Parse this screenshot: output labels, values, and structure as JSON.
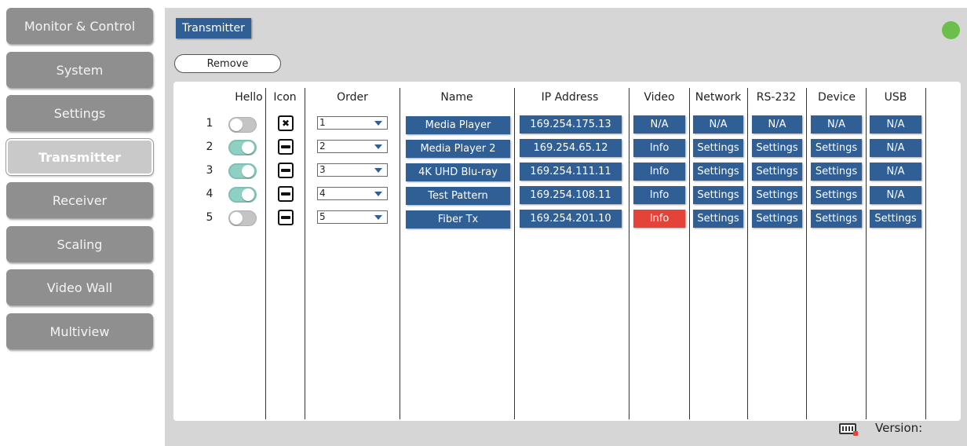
{
  "sidebar": {
    "items": [
      {
        "label": "Monitor & Control"
      },
      {
        "label": "System"
      },
      {
        "label": "Settings"
      },
      {
        "label": "Transmitter",
        "active": true
      },
      {
        "label": "Receiver"
      },
      {
        "label": "Scaling"
      },
      {
        "label": "Video Wall"
      },
      {
        "label": "Multiview"
      }
    ]
  },
  "page": {
    "title": "Transmitter",
    "status_color": "#6cbf4c",
    "remove_label": "Remove"
  },
  "table": {
    "headers": {
      "hello": "Hello",
      "icon": "Icon",
      "order": "Order",
      "name": "Name",
      "ip": "IP Address",
      "video": "Video",
      "network": "Network",
      "rs232": "RS-232",
      "device": "Device",
      "usb": "USB"
    },
    "rows": [
      {
        "num": "1",
        "hello_on": false,
        "icon": "disconnected-icon",
        "order": "1",
        "name": "Media Player",
        "ip": "169.254.175.13",
        "video": "N/A",
        "network": "N/A",
        "rs232": "N/A",
        "device": "N/A",
        "usb": "N/A"
      },
      {
        "num": "2",
        "hello_on": true,
        "icon": "device-icon",
        "order": "2",
        "name": "Media Player 2",
        "ip": "169.254.65.12",
        "video": "Info",
        "network": "Settings",
        "rs232": "Settings",
        "device": "Settings",
        "usb": "N/A"
      },
      {
        "num": "3",
        "hello_on": true,
        "icon": "device-icon",
        "order": "3",
        "name": "4K UHD Blu-ray",
        "ip": "169.254.111.11",
        "video": "Info",
        "network": "Settings",
        "rs232": "Settings",
        "device": "Settings",
        "usb": "N/A"
      },
      {
        "num": "4",
        "hello_on": true,
        "icon": "device-icon",
        "order": "4",
        "name": "Test Pattern",
        "ip": "169.254.108.11",
        "video": "Info",
        "network": "Settings",
        "rs232": "Settings",
        "device": "Settings",
        "usb": "N/A"
      },
      {
        "num": "5",
        "hello_on": false,
        "icon": "device-icon",
        "order": "5",
        "name": "Fiber Tx",
        "ip": "169.254.201.10",
        "video": "Info",
        "video_alert": true,
        "network": "Settings",
        "rs232": "Settings",
        "device": "Settings",
        "usb": "Settings"
      }
    ]
  },
  "footer": {
    "keyboard_icon": "keyboard-icon",
    "version_label": "Version:"
  },
  "colors": {
    "accent": "#2f5f95",
    "alert": "#e5433a",
    "status": "#6cbf4c",
    "toggle_on": "#8fd0c5"
  }
}
